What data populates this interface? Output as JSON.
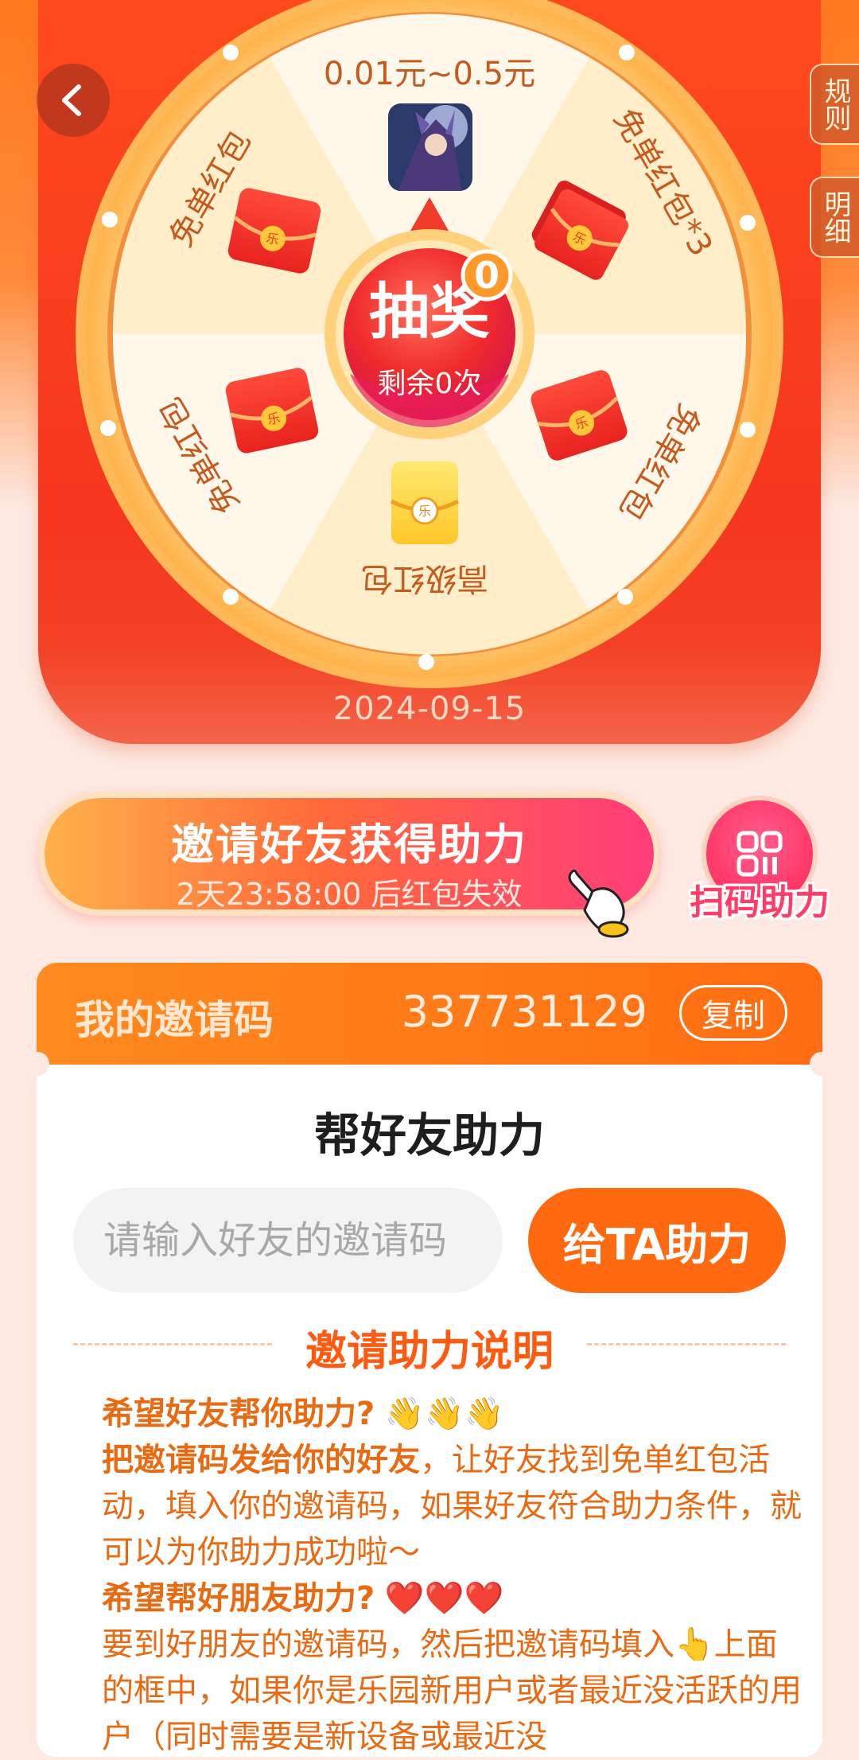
{
  "nav": {
    "back_icon": "chevron-left-icon"
  },
  "side_tabs": {
    "rules": "规则",
    "details": "明细"
  },
  "wheel": {
    "segments": [
      {
        "label": "0.01元~0.5元",
        "prize_icon": "game-character-thumbnail"
      },
      {
        "label": "免单红包*3",
        "prize_icon": "red-envelope-stack-icon"
      },
      {
        "label": "免单红包",
        "prize_icon": "red-envelope-icon"
      },
      {
        "label": "高级红包",
        "prize_icon": "gold-envelope-icon"
      },
      {
        "label": "免单红包",
        "prize_icon": "red-envelope-icon"
      },
      {
        "label": "免单红包",
        "prize_icon": "red-envelope-icon"
      }
    ],
    "spin_button": {
      "label": "抽奖",
      "remaining": "剩余0次",
      "badge_count": "0"
    },
    "date": "2024-09-15"
  },
  "invite": {
    "title": "邀请好友获得助力",
    "countdown": "2天23:58:00 后红包失效",
    "hand_icon": "pointing-hand-icon"
  },
  "scan": {
    "label": "扫码助力",
    "icon": "qr-scan-icon"
  },
  "my_code": {
    "label": "我的邀请码",
    "value": "337731129",
    "copy_label": "复制"
  },
  "help_friend": {
    "title": "帮好友助力",
    "input_placeholder": "请输入好友的邀请码",
    "button_label": "给TA助力"
  },
  "explanation": {
    "title": "邀请助力说明",
    "q1": "希望好友帮你助力?",
    "q1_emoji": "👋👋👋",
    "p1_bold": "把邀请码发给你的好友",
    "p1_rest": "，让好友找到免单红包活动，填入你的邀请码，如果好友符合助力条件，就可以为你助力成功啦～",
    "q2": "希望帮好朋友助力?",
    "q2_emoji": "❤️❤️❤️",
    "p2": "要到好朋友的邀请码，然后把邀请码填入👆上面的框中，如果你是乐园新用户或者最近没活跃的用户（同时需要是新设备或最近没"
  },
  "colors": {
    "brand_orange": "#ff6a10",
    "wheel_red": "#f5361f",
    "pink_accent": "#ff3d7a",
    "text_orange": "#e86a12"
  }
}
